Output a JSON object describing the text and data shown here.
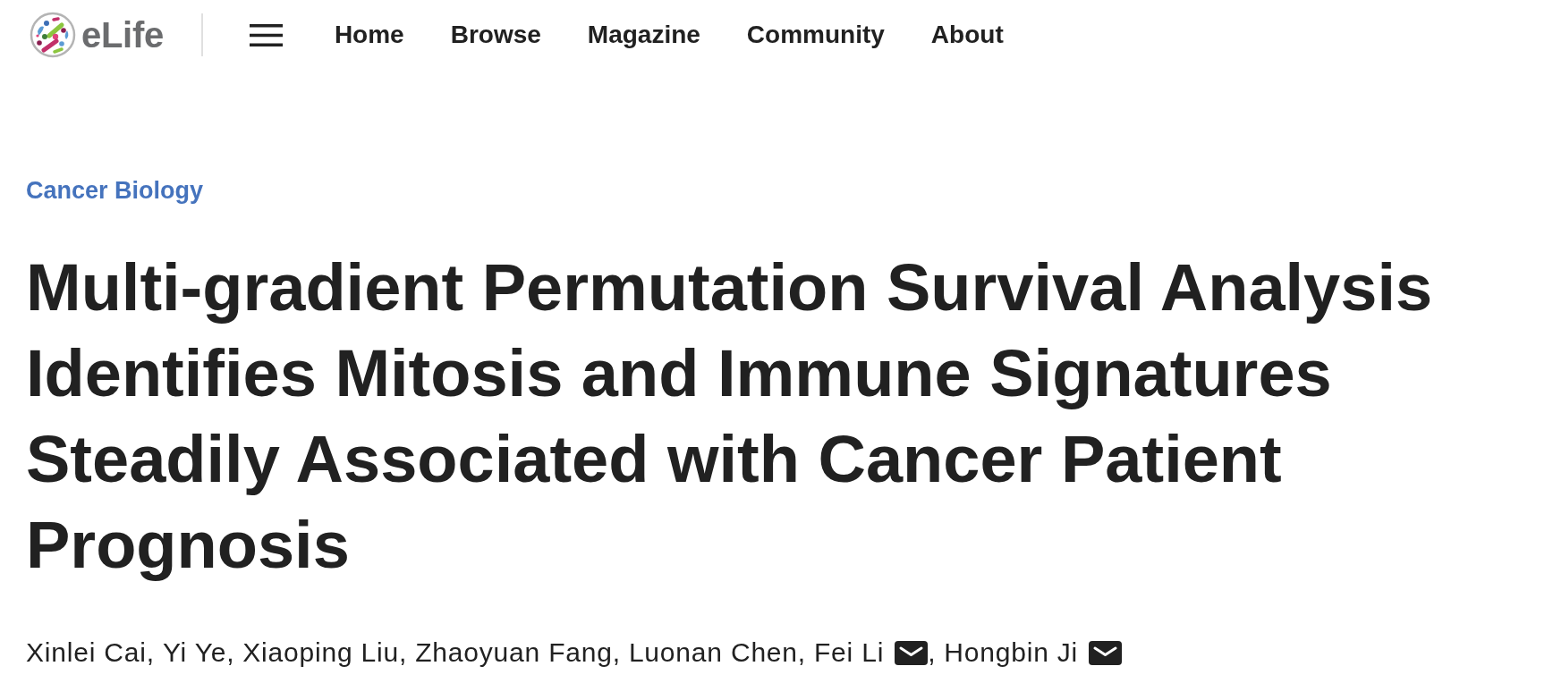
{
  "header": {
    "logo": {
      "text": "eLife"
    },
    "nav": [
      {
        "label": "Home"
      },
      {
        "label": "Browse"
      },
      {
        "label": "Magazine"
      },
      {
        "label": "Community"
      },
      {
        "label": "About"
      }
    ]
  },
  "article": {
    "subject": "Cancer Biology",
    "title": "Multi-gradient Permutation Survival Analysis Identifies Mitosis and Immune Signatures Steadily Associated with Cancer Patient Prognosis",
    "authors": [
      {
        "name": "Xinlei Cai",
        "corresponding": false,
        "separator": ","
      },
      {
        "name": "Yi Ye",
        "corresponding": false,
        "separator": ","
      },
      {
        "name": "Xiaoping Liu",
        "corresponding": false,
        "separator": ","
      },
      {
        "name": "Zhaoyuan Fang",
        "corresponding": false,
        "separator": ","
      },
      {
        "name": "Luonan Chen",
        "corresponding": false,
        "separator": ","
      },
      {
        "name": "Fei Li",
        "corresponding": true,
        "separator": ","
      },
      {
        "name": "Hongbin Ji",
        "corresponding": true
      }
    ]
  }
}
